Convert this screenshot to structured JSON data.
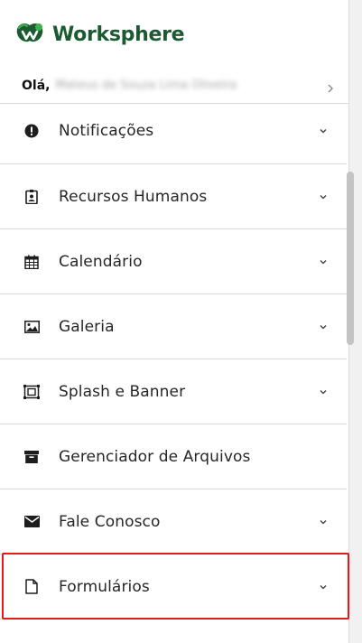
{
  "brand": {
    "name": "Worksphere",
    "logo_icon": "worksphere-logo-icon",
    "color": "#1c5a32",
    "accent": "#3bb34a"
  },
  "greeting": {
    "hello": "Olá,",
    "user_name": "Mateus de Souza Lima Oliveira",
    "chevron_icon": "chevron-right-icon"
  },
  "menu": {
    "items": [
      {
        "label": "Notificações",
        "icon": "alert-circle-icon",
        "expandable": true
      },
      {
        "label": "Recursos Humanos",
        "icon": "id-badge-icon",
        "expandable": true
      },
      {
        "label": "Calendário",
        "icon": "calendar-icon",
        "expandable": true
      },
      {
        "label": "Galeria",
        "icon": "image-icon",
        "expandable": true
      },
      {
        "label": "Splash e Banner",
        "icon": "splash-frame-icon",
        "expandable": true
      },
      {
        "label": "Gerenciador de Arquivos",
        "icon": "archive-box-icon",
        "expandable": false
      },
      {
        "label": "Fale Conosco",
        "icon": "envelope-icon",
        "expandable": true
      },
      {
        "label": "Formulários",
        "icon": "file-icon",
        "expandable": true
      }
    ]
  },
  "highlight_color": "#e81818"
}
